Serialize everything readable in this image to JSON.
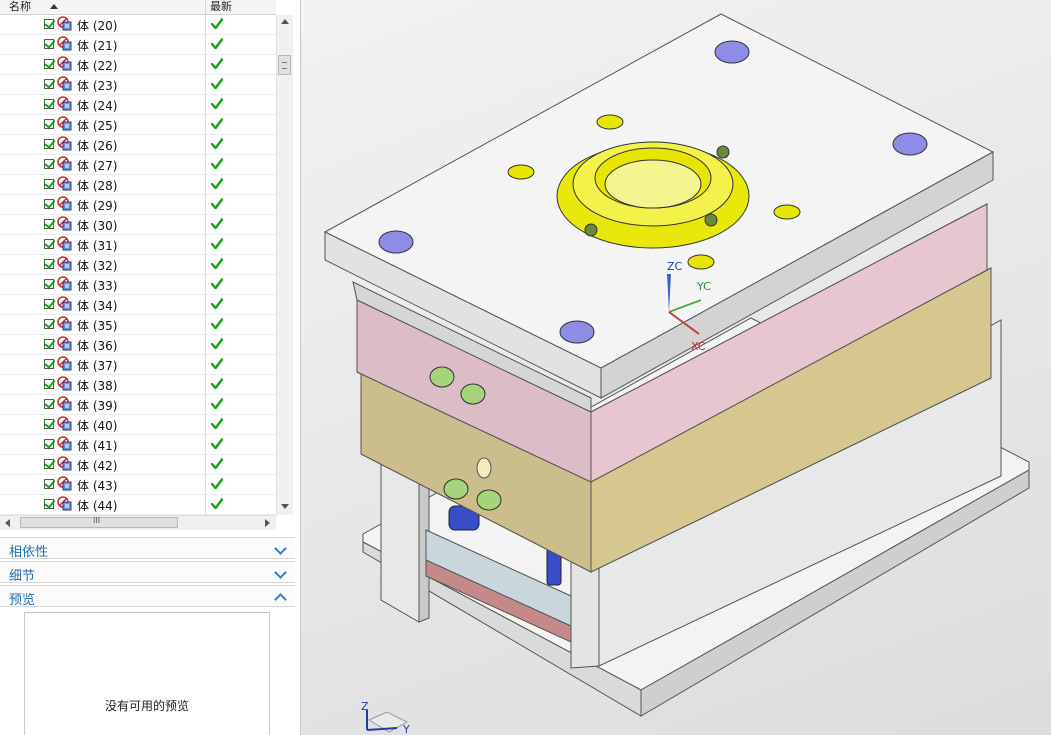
{
  "navigator": {
    "header": {
      "name_col": "名称",
      "latest_col": "最新"
    },
    "rows": [
      {
        "label": "体 (20)"
      },
      {
        "label": "体 (21)"
      },
      {
        "label": "体 (22)"
      },
      {
        "label": "体 (23)"
      },
      {
        "label": "体 (24)"
      },
      {
        "label": "体 (25)"
      },
      {
        "label": "体 (26)"
      },
      {
        "label": "体 (27)"
      },
      {
        "label": "体 (28)"
      },
      {
        "label": "体 (29)"
      },
      {
        "label": "体 (30)"
      },
      {
        "label": "体 (31)"
      },
      {
        "label": "体 (32)"
      },
      {
        "label": "体 (33)"
      },
      {
        "label": "体 (34)"
      },
      {
        "label": "体 (35)"
      },
      {
        "label": "体 (36)"
      },
      {
        "label": "体 (37)"
      },
      {
        "label": "体 (38)"
      },
      {
        "label": "体 (39)"
      },
      {
        "label": "体 (40)"
      },
      {
        "label": "体 (41)"
      },
      {
        "label": "体 (42)"
      },
      {
        "label": "体 (43)"
      },
      {
        "label": "体 (44)"
      }
    ],
    "hscroll_mark": "III",
    "sections": {
      "dependencies": "相依性",
      "details": "细节",
      "preview": "预览"
    },
    "preview_empty_text": "没有可用的预览"
  },
  "icons": {
    "checkbox": "checkbox-checked-icon",
    "body": "solid-body-icon",
    "status": "green-check-icon",
    "sort": "sort-ascending-icon"
  },
  "viewport": {
    "csys": {
      "z": "ZC",
      "y": "YC",
      "x": "XC"
    },
    "triad": {
      "z": "Z",
      "y": "Y"
    }
  },
  "colors": {
    "accent": "#1f6db3",
    "check_green": "#18a018",
    "top_plate": "#f2f2f2",
    "pink_plate": "#e9c9d2",
    "tan_plate": "#d8c99a",
    "sprue_yellow": "#e6e60a",
    "bolt_blue": "#8a8ae6",
    "fitting_green": "#a8d870"
  }
}
